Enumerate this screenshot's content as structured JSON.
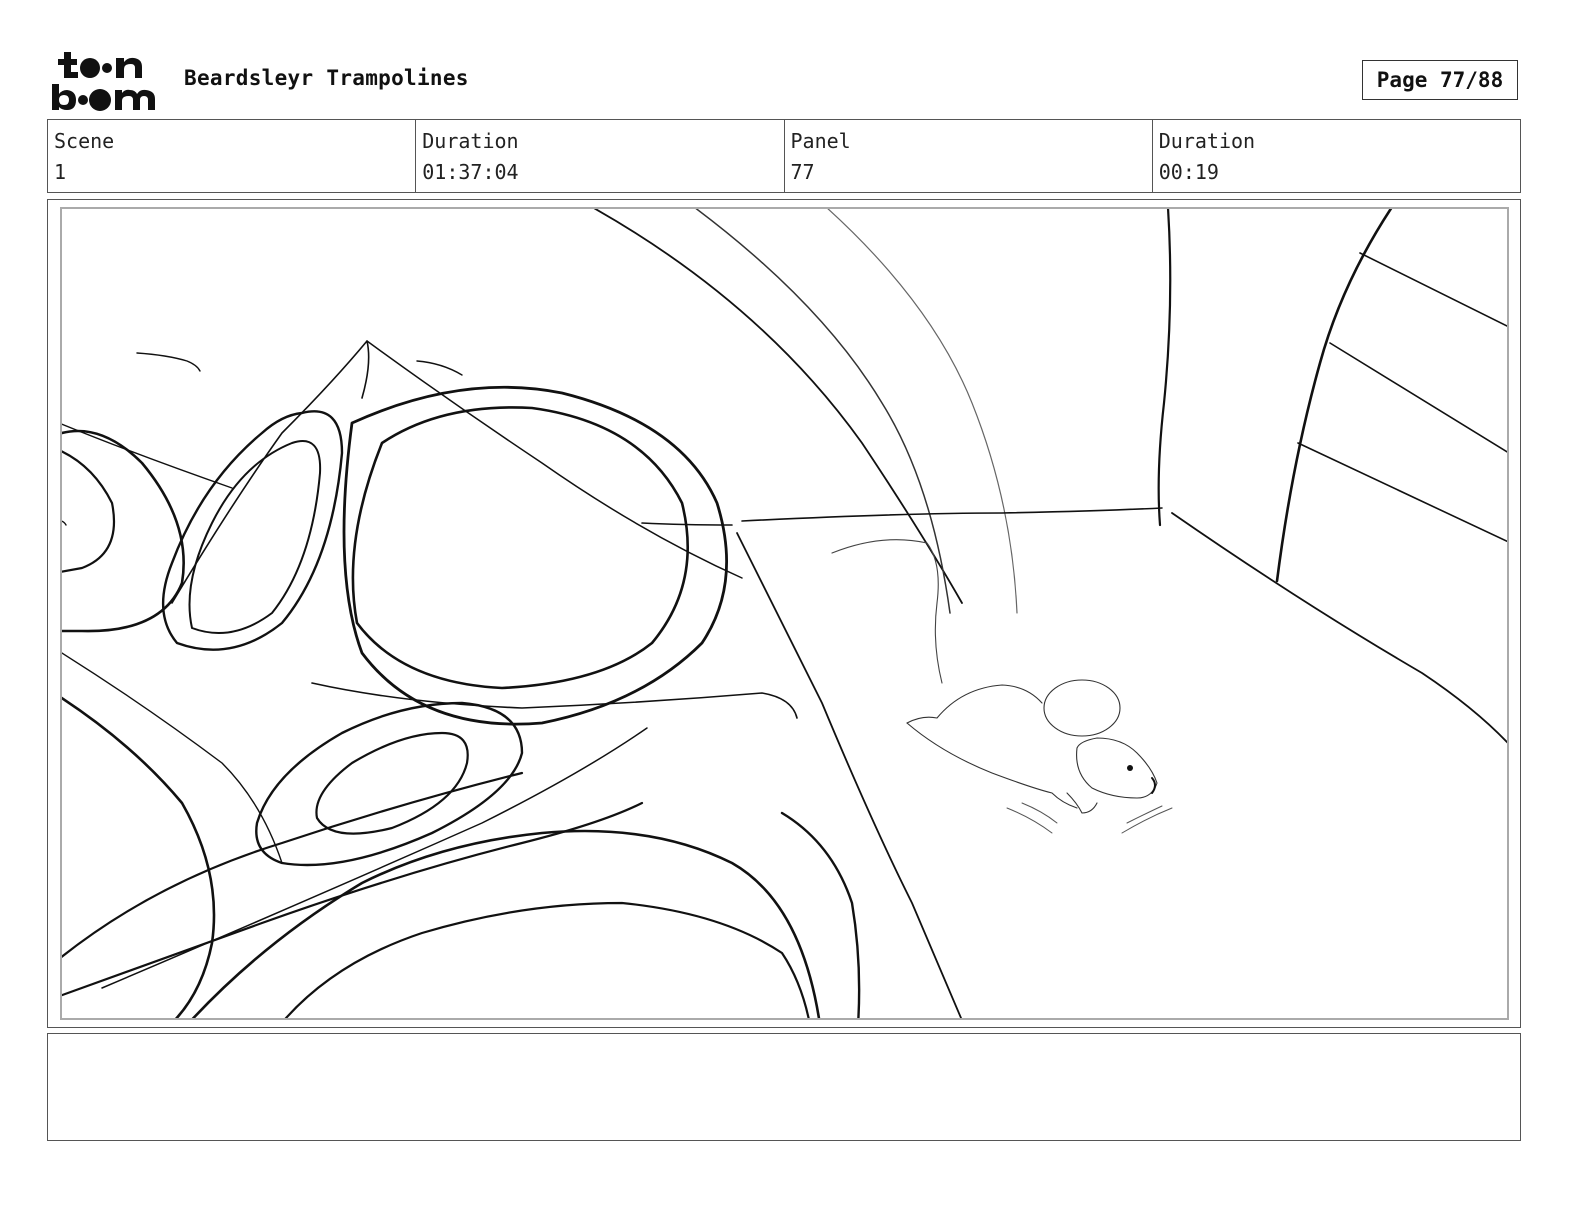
{
  "header": {
    "project_title": "Beardsleyr Trampolines",
    "page_label": "Page 77/88",
    "logo_alt": "toon boom"
  },
  "info": {
    "scene_label": "Scene",
    "scene_value": "1",
    "duration_label": "Duration",
    "duration_value": "01:37:04",
    "panel_label": "Panel",
    "panel_value": "77",
    "panel_duration_label": "Duration",
    "panel_duration_value": "00:19"
  },
  "notes": {
    "text": ""
  }
}
